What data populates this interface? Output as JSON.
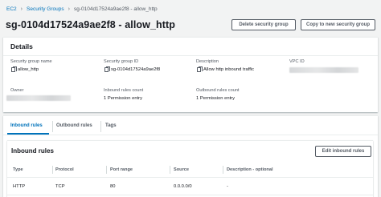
{
  "breadcrumb": {
    "items": [
      "EC2",
      "Security Groups",
      "sg-0104d17524a9ae2f8 - allow_http"
    ],
    "separator": "›"
  },
  "header": {
    "title": "sg-0104d17524a9ae2f8 - allow_http",
    "delete_label": "Delete security group",
    "copy_label": "Copy to new security group"
  },
  "details": {
    "title": "Details",
    "fields": {
      "name_label": "Security group name",
      "name_value": "allow_http",
      "id_label": "Security group ID",
      "id_value": "sg-0104d17524a9ae2f8",
      "description_label": "Description",
      "description_value": "Allow http inbound traffic",
      "vpc_label": "VPC ID",
      "owner_label": "Owner",
      "inbound_count_label": "Inbound rules count",
      "inbound_count_value": "1 Permission entry",
      "outbound_count_label": "Outbound rules count",
      "outbound_count_value": "1 Permission entry"
    }
  },
  "tabs": [
    {
      "label": "Inbound rules",
      "active": true
    },
    {
      "label": "Outbound rules",
      "active": false
    },
    {
      "label": "Tags",
      "active": false
    }
  ],
  "inbound": {
    "title": "Inbound rules",
    "edit_label": "Edit inbound rules",
    "columns": [
      "Type",
      "Protocol",
      "Port range",
      "Source",
      "Description - optional"
    ],
    "rows": [
      [
        "HTTP",
        "TCP",
        "80",
        "0.0.0.0/0",
        "-"
      ]
    ]
  },
  "colors": {
    "link": "#0073bb",
    "background": "#f2f3f3",
    "text": "#16191f",
    "muted": "#545b64"
  }
}
